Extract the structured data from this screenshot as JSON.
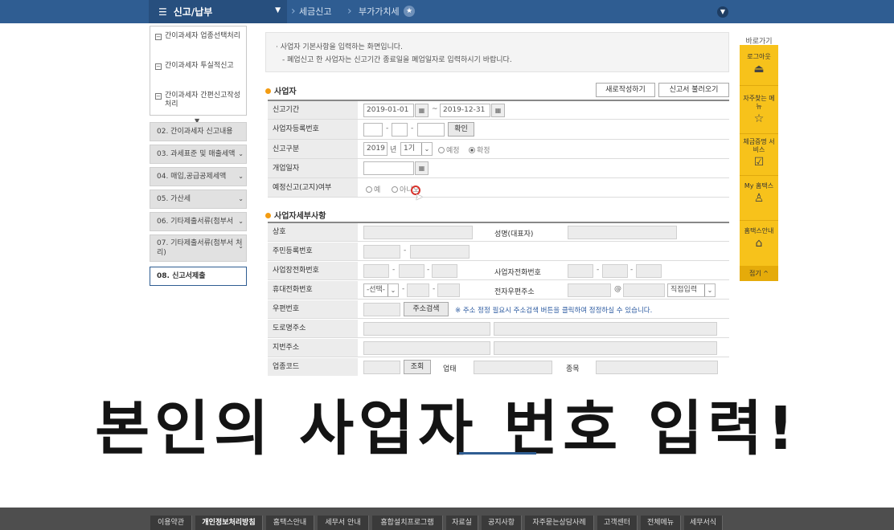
{
  "topbar": {
    "menu_label": "신고/납부",
    "breadcrumb_1": "세금신고",
    "breadcrumb_2": "부가가치세"
  },
  "submenu": {
    "items": [
      "간이과세자 업종선택처리",
      "간이과세자 투실적신고",
      "간이과세자 간편신고작성 처리"
    ]
  },
  "nav": {
    "items": [
      "02. 간이과세자 신고내용",
      "03. 과세표준 및 매출세액",
      "04. 매입,공급공제세액",
      "05. 가산세",
      "06. 기타제출서류(첨부서",
      "07. 기타제출서류(첨부서 처리)",
      "08. 신고서제출"
    ]
  },
  "notice": {
    "line1": "· 사업자 기본사항을 입력하는 화면입니다.",
    "line2": "- 폐업신고 한 사업자는 신고기간 종료일을 폐업일자로 입력하시기 바랍니다."
  },
  "section1": {
    "title": "사업자",
    "new_button": "새로작성하기",
    "load_button": "신고서 불러오기",
    "labels": {
      "period": "신고기간",
      "bizno": "사업자등록번호",
      "type": "신고구분",
      "closedate": "개업일자",
      "correction": "예정신고(고지)여부"
    },
    "period_from": "2019-01-01",
    "period_to": "2019-12-31",
    "confirm_button": "확인",
    "year": "2019",
    "year_unit": "년",
    "term": "1기",
    "type_options": [
      "예정",
      "확정"
    ],
    "yn_options": [
      "예",
      "아니오"
    ]
  },
  "section2": {
    "title": "사업자세부사항",
    "labels": {
      "company": "상호",
      "name": "성명(대표자)",
      "rrn": "주민등록번호",
      "office_tel": "사업장전화번호",
      "home_tel": "사업자전화번호",
      "mobile": "휴대전화번호",
      "email": "전자우편주소",
      "zip": "우편번호",
      "road": "도로명주소",
      "jibun": "지번주소",
      "industry": "업종코드"
    },
    "mobile_select": "-선택-",
    "email_at": "@",
    "email_select": "직접입력",
    "zip_button": "주소검색",
    "zip_note": "※ 주소 정정 필요시 주소검색 버튼을 클릭하여 정정하실 수 있습니다.",
    "industry_button": "조회",
    "industry_type_label": "업태",
    "industry_item_label": "종목"
  },
  "quick": {
    "title": "바로가기",
    "items": [
      "로그아웃",
      "자주찾는 메뉴",
      "체금증명 서비스",
      "My 홈택스",
      "홈택스안내"
    ],
    "close": "접기 ^"
  },
  "caption": {
    "text": "본인의 사업자 번호 입력!"
  },
  "footer": {
    "links": [
      "이용약관",
      "개인정보처리방침",
      "홈택스안내",
      "세무서 안내",
      "홈합설치프로그램",
      "자료실",
      "공지사항",
      "자주묻는상담사례",
      "고객센터",
      "전체메뉴",
      "세무서식"
    ]
  }
}
